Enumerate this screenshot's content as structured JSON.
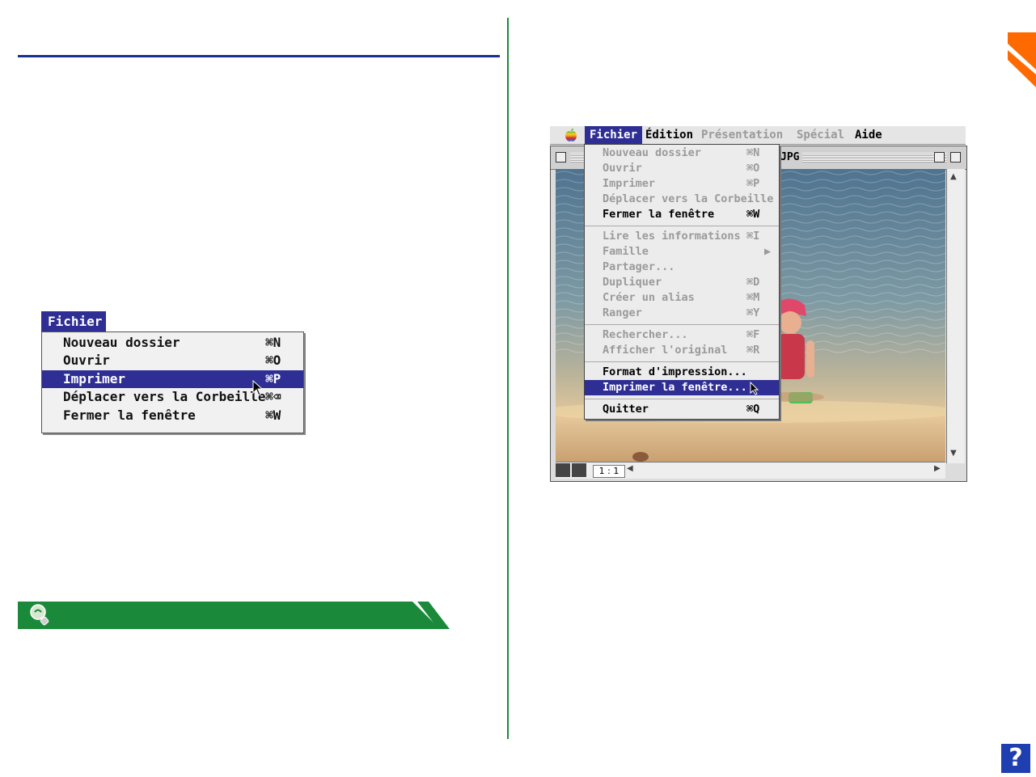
{
  "left_menu": {
    "title": "Fichier",
    "items": [
      {
        "label": "Nouveau dossier",
        "shortcut": "⌘N"
      },
      {
        "label": "Ouvrir",
        "shortcut": "⌘O"
      },
      {
        "label": "Imprimer",
        "shortcut": "⌘P",
        "highlighted": true
      },
      {
        "label": "Déplacer vers la Corbeille",
        "shortcut": "⌘⌫"
      },
      {
        "label": "Fermer la fenêtre",
        "shortcut": "⌘W"
      }
    ]
  },
  "screenshot": {
    "menubar": {
      "apple_icon": "apple-logo-icon",
      "menus": [
        "Fichier",
        "Édition",
        "Présentation",
        "Spécial",
        "Aide"
      ]
    },
    "window": {
      "title": "JPG",
      "zoom": "1 : 1"
    },
    "dropdown": {
      "items": [
        {
          "label": "Nouveau dossier",
          "shortcut": "⌘N",
          "enabled": false
        },
        {
          "label": "Ouvrir",
          "shortcut": "⌘O",
          "enabled": false
        },
        {
          "label": "Imprimer",
          "shortcut": "⌘P",
          "enabled": false
        },
        {
          "label": "Déplacer vers la Corbeille",
          "shortcut": "",
          "enabled": false
        },
        {
          "label": "Fermer la fenêtre",
          "shortcut": "⌘W",
          "enabled": true
        },
        {
          "label": "Lire les informations",
          "shortcut": "⌘I",
          "enabled": false
        },
        {
          "label": "Famille",
          "shortcut": "▶",
          "enabled": false
        },
        {
          "label": "Partager...",
          "shortcut": "",
          "enabled": false
        },
        {
          "label": "Dupliquer",
          "shortcut": "⌘D",
          "enabled": false
        },
        {
          "label": "Créer un alias",
          "shortcut": "⌘M",
          "enabled": false
        },
        {
          "label": "Ranger",
          "shortcut": "⌘Y",
          "enabled": false
        },
        {
          "label": "Rechercher...",
          "shortcut": "⌘F",
          "enabled": false
        },
        {
          "label": "Afficher l'original",
          "shortcut": "⌘R",
          "enabled": false
        },
        {
          "label": "Format d'impression...",
          "shortcut": "",
          "enabled": true
        },
        {
          "label": "Imprimer la fenêtre...",
          "shortcut": "",
          "enabled": true,
          "highlighted": true
        },
        {
          "label": "Quitter",
          "shortcut": "⌘Q",
          "enabled": true
        }
      ]
    }
  },
  "help_button": {
    "label": "?"
  },
  "colors": {
    "accent_blue": "#2e2e94",
    "rule_blue": "#1a2f8f",
    "divider_green": "#1a8a3a",
    "tab_orange": "#ff6a00"
  }
}
